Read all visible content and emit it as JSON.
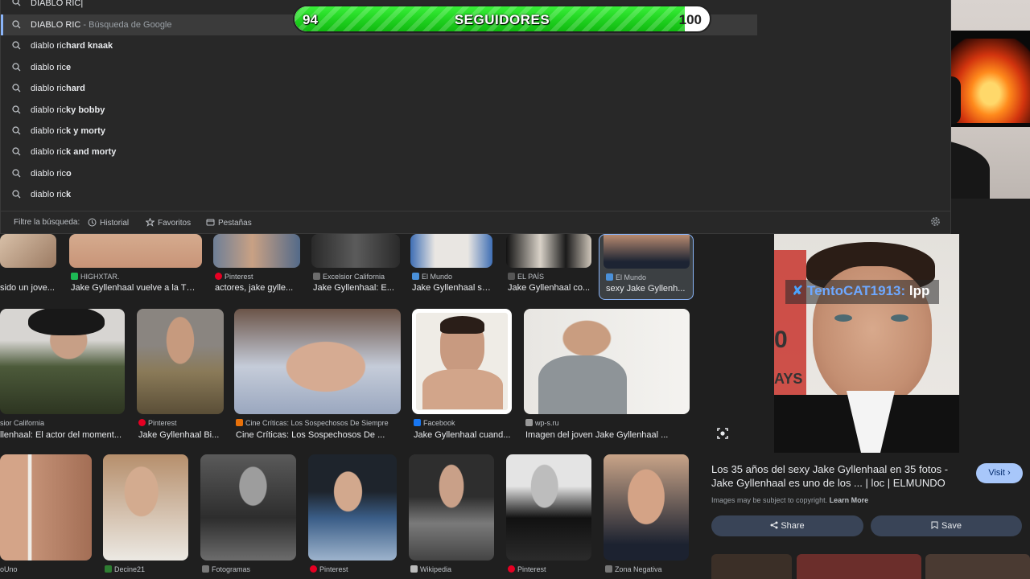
{
  "omnibox": {
    "query": "DIABLO RIC|",
    "suggestions": [
      {
        "prefix": "DIABLO RIC",
        "suffix": "",
        "sub": " - Búsqueda de Google",
        "selected": true
      },
      {
        "prefix": "diablo ric",
        "suffix": "hard knaak",
        "sub": ""
      },
      {
        "prefix": "diablo ric",
        "suffix": "e",
        "sub": ""
      },
      {
        "prefix": "diablo ric",
        "suffix": "hard",
        "sub": ""
      },
      {
        "prefix": "diablo ric",
        "suffix": "ky bobby",
        "sub": ""
      },
      {
        "prefix": "diablo ric",
        "suffix": "k y morty",
        "sub": ""
      },
      {
        "prefix": "diablo ric",
        "suffix": "k and morty",
        "sub": ""
      },
      {
        "prefix": "diablo ric",
        "suffix": "o",
        "sub": ""
      },
      {
        "prefix": "diablo ric",
        "suffix": "k",
        "sub": ""
      }
    ],
    "filter_label": "Filtre la búsqueda:",
    "filters": [
      "Historial",
      "Favoritos",
      "Pestañas"
    ]
  },
  "follow_goal": {
    "current": "94",
    "label": "SEGUIDORES",
    "target": "100",
    "progress": 0.94
  },
  "grid": {
    "row1": [
      {
        "src": "",
        "cap": "sido un jove...",
        "color": "#777"
      },
      {
        "src": "HIGHXTAR.",
        "cap": "Jake Gyllenhaal vuelve a la TV ...",
        "color": "#1db954"
      },
      {
        "src": "Pinterest",
        "cap": "actores, jake gylle...",
        "color": "#e60023"
      },
      {
        "src": "Excelsior California",
        "cap": "Jake Gyllenhaal: E...",
        "color": "#6d6d6d"
      },
      {
        "src": "El Mundo",
        "cap": "Jake Gyllenhaal se...",
        "color": "#4a90d9"
      },
      {
        "src": "EL PAÍS",
        "cap": "Jake Gyllenhaal co...",
        "color": "#555"
      },
      {
        "src": "El Mundo",
        "cap": "sexy Jake Gyllenh...",
        "color": "#4a90d9"
      }
    ],
    "row2": [
      {
        "src": "sior California",
        "cap": "llenhaal: El actor del moment...",
        "color": "#6d6d6d"
      },
      {
        "src": "Pinterest",
        "cap": "Jake Gyllenhaal Bi...",
        "color": "#e60023"
      },
      {
        "src": "Cine Críticas: Los Sospechosos De Siempre",
        "cap": "Cine Críticas: Los Sospechosos De ...",
        "color": "#e8710a"
      },
      {
        "src": "Facebook",
        "cap": "Jake Gyllenhaal cuand...",
        "color": "#1877f2"
      },
      {
        "src": "wp-s.ru",
        "cap": "Imagen del joven Jake Gyllenhaal ...",
        "color": "#999"
      }
    ],
    "row3": [
      {
        "src": "oUno",
        "color": "#777"
      },
      {
        "src": "Decine21",
        "color": "#2e7d32"
      },
      {
        "src": "Fotogramas",
        "color": "#777"
      },
      {
        "src": "Pinterest",
        "color": "#e60023"
      },
      {
        "src": "Wikipedia",
        "color": "#bbb"
      },
      {
        "src": "Pinterest",
        "color": "#e60023"
      },
      {
        "src": "Zona Negativa",
        "color": "#777"
      }
    ]
  },
  "preview": {
    "title": "Los 35 años del sexy Jake Gyllenhaal en 35 fotos - Jake Gyllenhaal es uno de los ... | loc | ELMUNDO",
    "visit": "Visit",
    "copyright": "Images may be subject to copyright.",
    "learn_more": "Learn More",
    "share": "Share",
    "save": "Save"
  },
  "chat": {
    "user": "TentoCAT1913:",
    "message": "lpp"
  }
}
